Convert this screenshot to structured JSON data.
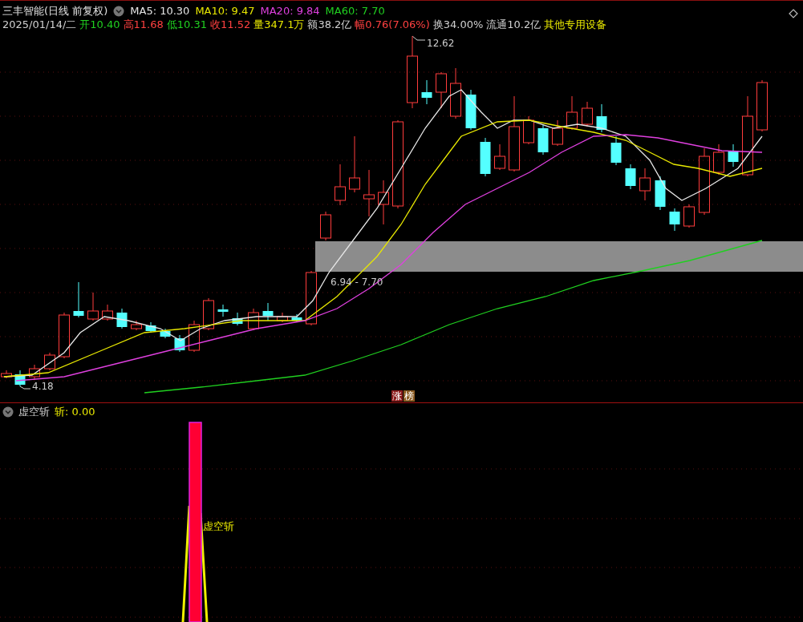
{
  "header": {
    "title": "三丰智能(日线 前复权)",
    "ma": [
      {
        "label": "MA5: 10.30",
        "color": "#e6e6e6"
      },
      {
        "label": "MA10: 9.47",
        "color": "#e8e800"
      },
      {
        "label": "MA20: 9.84",
        "color": "#e040e0"
      },
      {
        "label": "MA60: 7.70",
        "color": "#20d020"
      }
    ],
    "quote": [
      {
        "text": "2025/01/14/二",
        "color": "#d0d0d0"
      },
      {
        "text": "开10.40",
        "color": "#20d020"
      },
      {
        "text": "高11.68",
        "color": "#ff4040"
      },
      {
        "text": "低10.31",
        "color": "#20d020"
      },
      {
        "text": "收11.52",
        "color": "#ff4040"
      },
      {
        "text": "量347.1万",
        "color": "#e8e800"
      },
      {
        "text": "额38.2亿",
        "color": "#d0d0d0"
      },
      {
        "text": "幅0.76(7.06%)",
        "color": "#ff4040"
      },
      {
        "text": "换34.00%",
        "color": "#d0d0d0"
      },
      {
        "text": "流通10.2亿",
        "color": "#d0d0d0"
      },
      {
        "text": "其他专用设备",
        "color": "#e8e800"
      }
    ]
  },
  "chart": {
    "high_label": "12.62",
    "low_label": "4.18",
    "range_label": "6.94 - 7.70",
    "badges": [
      {
        "text": "涨",
        "color": "#8a1c1c"
      },
      {
        "text": "榜",
        "color": "#8a5a20"
      }
    ]
  },
  "indicator": {
    "name": "虚空斩",
    "value_label": "斩: 0.00",
    "signal_label": "虚空斩"
  }
}
